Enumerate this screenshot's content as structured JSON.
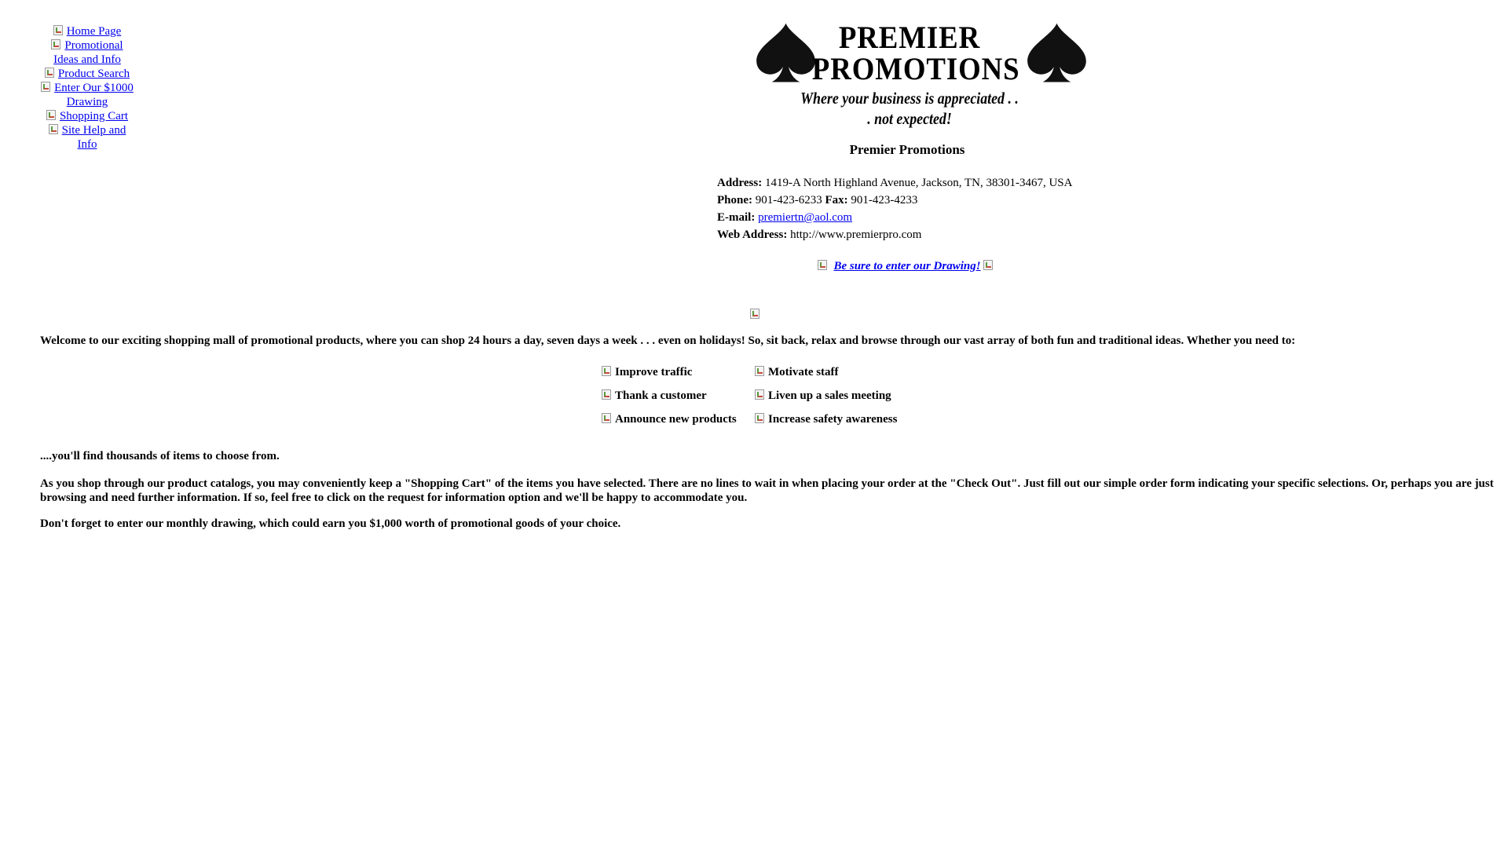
{
  "nav": [
    {
      "id": "home",
      "label": "Home Page"
    },
    {
      "id": "promo",
      "label": "Promotional Ideas and Info"
    },
    {
      "id": "search",
      "label": "Product Search"
    },
    {
      "id": "drawing",
      "label": "Enter Our $1000 Drawing"
    },
    {
      "id": "cart",
      "label": "Shopping Cart"
    },
    {
      "id": "help",
      "label": "Site Help and Info"
    }
  ],
  "logo": {
    "line1": "PREMIER",
    "line2": "PROMOTIONS",
    "tagline": "Where your business is appreciated . . . not expected!"
  },
  "company": {
    "name": "Premier Promotions",
    "address_label": "Address:",
    "address": "1419-A North Highland Avenue, Jackson, TN, 38301-3467, USA",
    "phone_label": "Phone:",
    "phone": "901-423-6233",
    "fax_label": "Fax:",
    "fax": "901-423-4233",
    "email_label": "E-mail:",
    "email": "premiertn@aol.com",
    "web_label": "Web Address:",
    "web": "http://www.premierpro.com"
  },
  "drawing_link": "Be sure to enter our Drawing!",
  "welcome_text": "Welcome to our exciting shopping mall of promotional products, where you can shop 24 hours a day, seven days a week . . . even on holidays! So, sit back, relax and browse through our vast array of both fun and traditional ideas. Whether you need to:",
  "needs": [
    "Improve traffic",
    "Motivate staff",
    "Thank a customer",
    "Liven up a sales meeting",
    "Announce new products",
    "Increase safety awareness"
  ],
  "items_line": "....you'll find thousands of items to choose from.",
  "shopping_paragraph": "As you shop through our product catalogs, you may conveniently keep a \"Shopping Cart\" of the items you have selected. There are no lines to wait in when placing your order at the \"Check Out\". Just fill out our simple order form indicating your specific selections. Or, perhaps you are just browsing and need further information. If so, feel free to click on the request for information option and we'll be happy to accommodate you.",
  "drawing_reminder": "Don't forget to enter our monthly drawing, which could earn you $1,000 worth of promotional goods of your choice.",
  "colors": {
    "link": "#0000ee",
    "text": "#000000",
    "background": "#ffffff"
  }
}
